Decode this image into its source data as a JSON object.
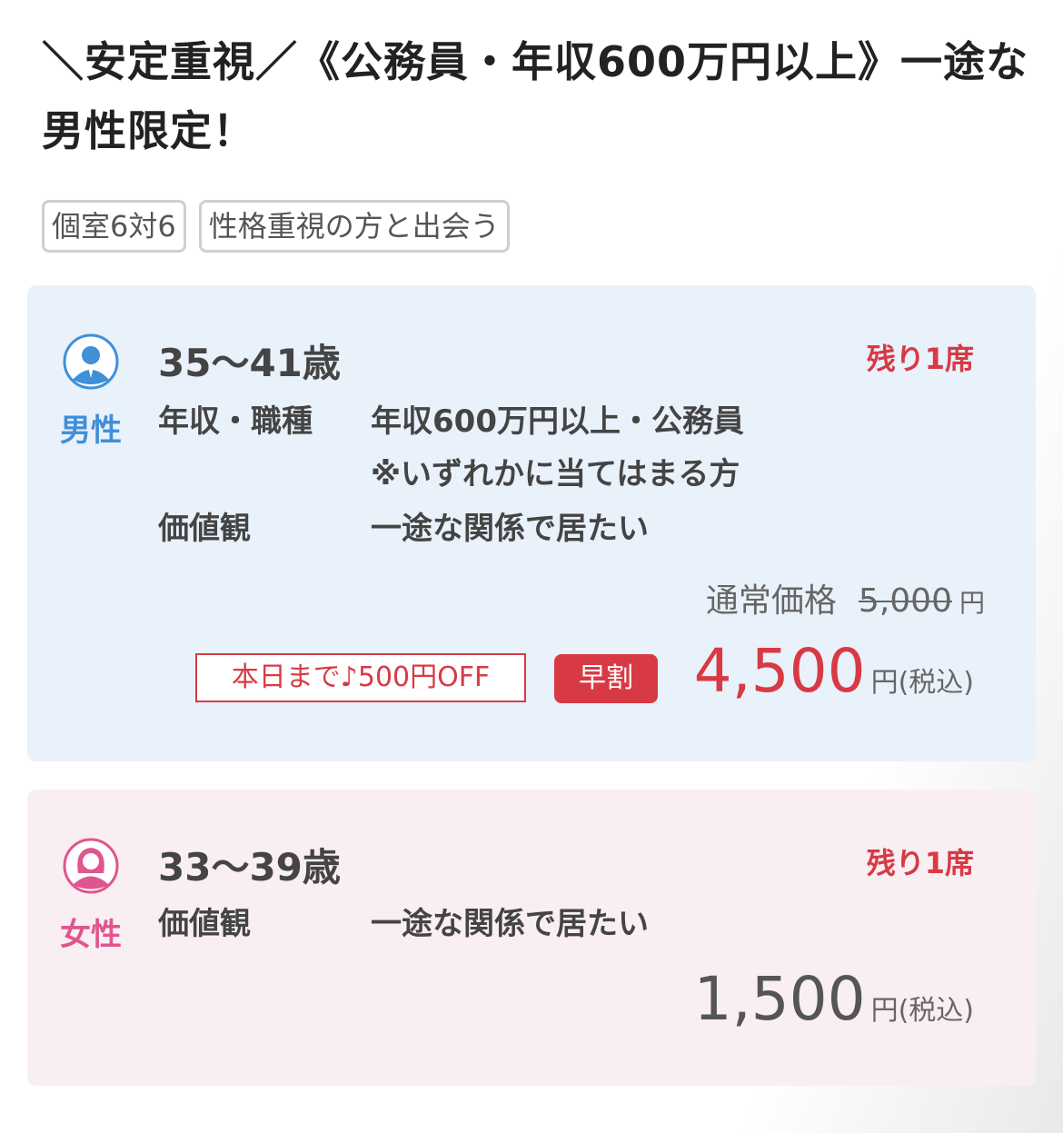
{
  "title": "＼安定重視／《公務員・年収600万円以上》一途な男性限定！",
  "tags": [
    "個室6対6",
    "性格重視の方と出会う"
  ],
  "male": {
    "label": "男性",
    "age": "35〜41歳",
    "remaining": "残り1席",
    "attributes": [
      {
        "label": "年収・職種",
        "value": "年収600万円以上・公務員"
      },
      {
        "label": "",
        "value": "※いずれかに当てはまる方"
      },
      {
        "label": "価値観",
        "value": "一途な関係で居たい"
      }
    ],
    "regular_price_label": "通常価格",
    "regular_price": "5,000",
    "regular_price_unit": "円",
    "discount_text": "本日まで♪500円OFF",
    "badge": "早割",
    "price": "4,500",
    "price_unit": "円(税込)"
  },
  "female": {
    "label": "女性",
    "age": "33〜39歳",
    "remaining": "残り1席",
    "attributes": [
      {
        "label": "価値観",
        "value": "一途な関係で居たい"
      }
    ],
    "price": "1,500",
    "price_unit": "円(税込)"
  },
  "colors": {
    "accent_red": "#d83a45",
    "male_blue": "#3f8fd9",
    "female_pink": "#e0558f",
    "male_card_bg": "#e9f1fa",
    "female_card_bg": "#f9eef2"
  },
  "icons": {
    "male": "male-avatar-icon",
    "female": "female-avatar-icon"
  }
}
